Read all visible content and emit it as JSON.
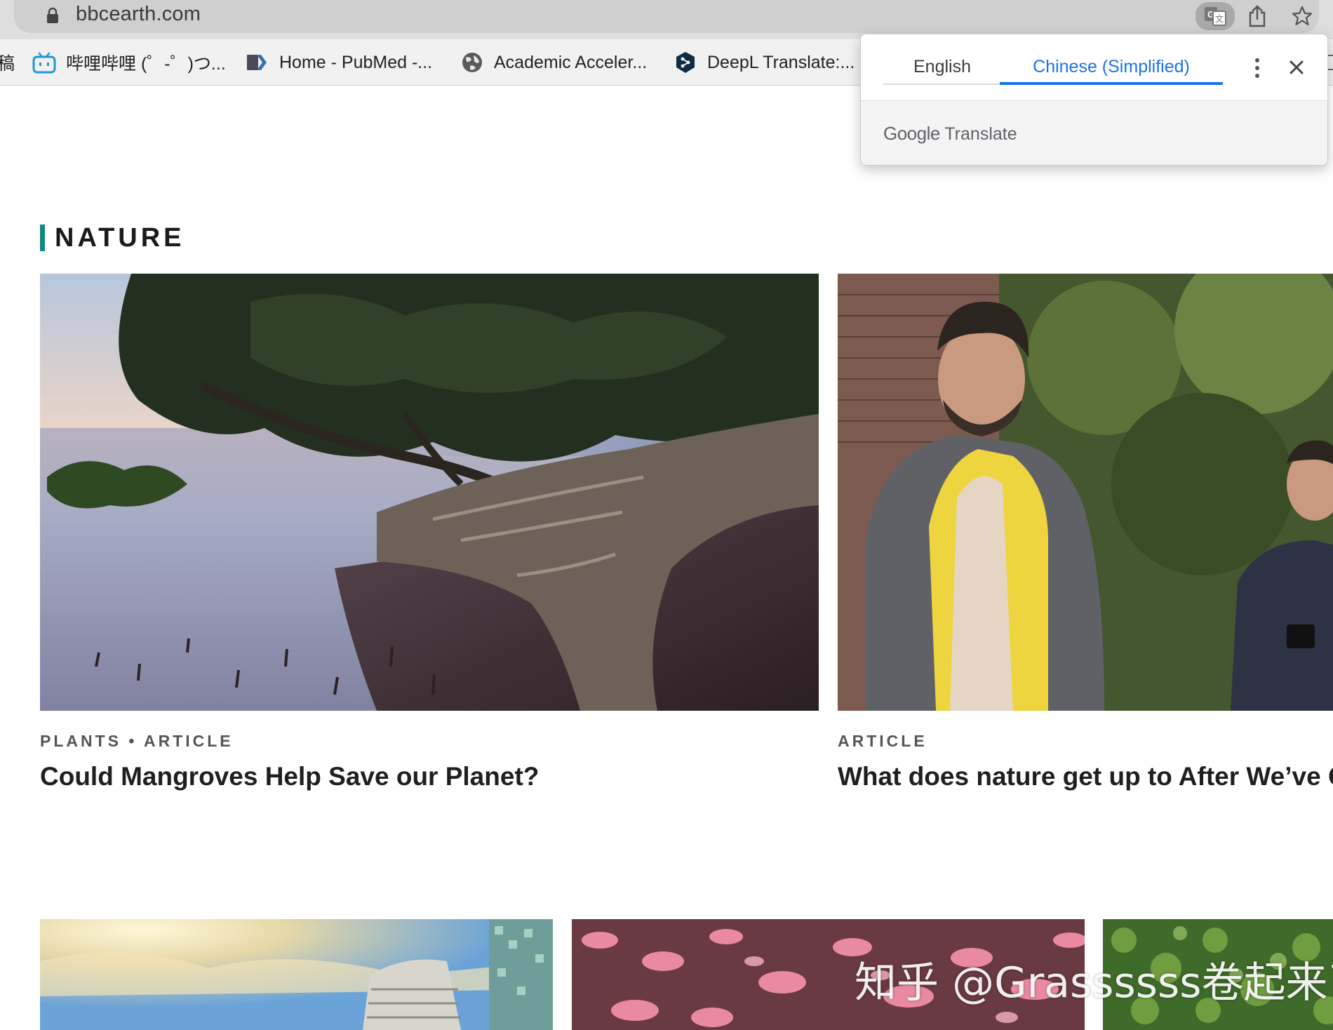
{
  "browser": {
    "url": "bbcearth.com",
    "bookmarks": [
      {
        "label": "稿",
        "icon": "partial-icon"
      },
      {
        "label": "哔哩哔哩 (゜-゜)つ...",
        "icon": "bilibili-icon"
      },
      {
        "label": "Home - PubMed -...",
        "icon": "pubmed-icon"
      },
      {
        "label": "Academic Acceler...",
        "icon": "globe-icon"
      },
      {
        "label": "DeepL Translate:...",
        "icon": "deepl-icon"
      }
    ]
  },
  "translate_popup": {
    "tabs": [
      {
        "label": "English",
        "selected": false
      },
      {
        "label": "Chinese (Simplified)",
        "selected": true
      }
    ],
    "brand_google": "Google",
    "brand_translate": "Translate",
    "accent_color": "#1a73e8"
  },
  "section": {
    "heading": "NATURE",
    "accent_color": "#0f8a7e"
  },
  "cards": [
    {
      "kicker": "PLANTS • ARTICLE",
      "title": "Could Mangroves Help Save our Planet?"
    },
    {
      "kicker": "ARTICLE",
      "title": "What does nature get up to After We’ve Go"
    }
  ],
  "watermark": "知乎 @Grassssss卷起来了"
}
